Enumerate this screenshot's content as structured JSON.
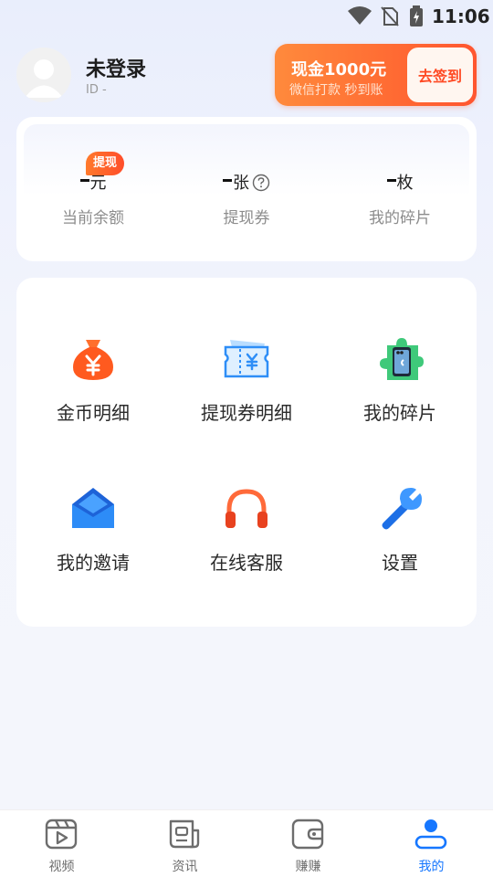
{
  "status_bar": {
    "time": "11:06",
    "icons": [
      "wifi-icon",
      "no-sim-icon",
      "battery-charging-icon"
    ]
  },
  "user": {
    "name": "未登录",
    "id_text": "ID -",
    "avatar_icon": "default-avatar-icon"
  },
  "checkin": {
    "title": "现金1000元",
    "subtitle": "微信打款 秒到账",
    "button_label": "去签到"
  },
  "stats": {
    "withdraw_tag": "提现",
    "items": [
      {
        "value": "-",
        "unit": "元",
        "label": "当前余额"
      },
      {
        "value": "-",
        "unit": "张",
        "label": "提现券",
        "icon": "help-circle-icon"
      },
      {
        "value": "-",
        "unit": "枚",
        "label": "我的碎片"
      }
    ]
  },
  "menu": {
    "items": [
      {
        "label": "金币明细",
        "icon": "money-bag-icon"
      },
      {
        "label": "提现券明细",
        "icon": "ticket-icon"
      },
      {
        "label": "我的碎片",
        "icon": "puzzle-phone-icon"
      },
      {
        "label": "我的邀请",
        "icon": "envelope-icon"
      },
      {
        "label": "在线客服",
        "icon": "headphones-icon"
      },
      {
        "label": "设置",
        "icon": "wrench-icon"
      }
    ]
  },
  "bottom_nav": {
    "items": [
      {
        "label": "视频",
        "icon": "video-icon",
        "active": false
      },
      {
        "label": "资讯",
        "icon": "news-icon",
        "active": false
      },
      {
        "label": "赚赚",
        "icon": "wallet-icon",
        "active": false
      },
      {
        "label": "我的",
        "icon": "profile-icon",
        "active": true
      }
    ]
  },
  "colors": {
    "accent": "#1677ff",
    "banner_orange": "#ff6a33",
    "tag_red": "#ff4d2a"
  }
}
